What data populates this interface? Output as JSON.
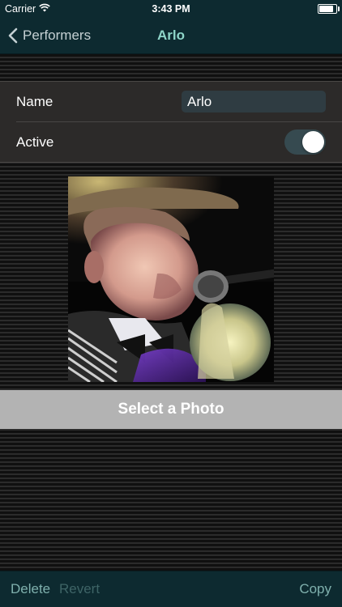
{
  "status_bar": {
    "carrier": "Carrier",
    "time": "3:43 PM",
    "battery_level": 0.95,
    "icons": [
      "wifi-icon",
      "battery-icon"
    ]
  },
  "nav": {
    "back_label": "Performers",
    "title": "Arlo",
    "back_icon": "chevron-left-icon"
  },
  "form": {
    "name_label": "Name",
    "name_value": "Arlo",
    "active_label": "Active",
    "active_on": true
  },
  "photo": {
    "select_label": "Select a Photo"
  },
  "toolbar": {
    "delete_label": "Delete",
    "revert_label": "Revert",
    "copy_label": "Copy"
  },
  "colors": {
    "bar_background": "#0d2a30",
    "title_tint": "#8ed6c9",
    "toolbar_tint": "#7fb0ad",
    "toolbar_disabled": "#3e6466",
    "select_button_bg": "#b3b3b3"
  }
}
